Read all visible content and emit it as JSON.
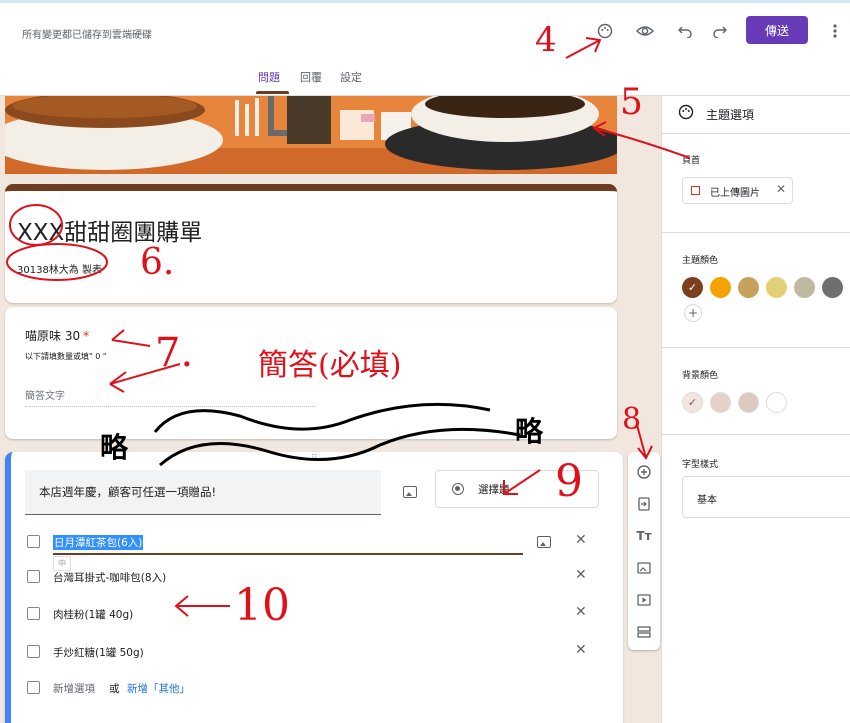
{
  "topbar": {
    "save_status": "所有變更都已儲存到雲端硬碟",
    "send_label": "傳送",
    "icons": [
      "palette-icon",
      "eye-icon",
      "undo-icon",
      "redo-icon",
      "more-vert-icon"
    ]
  },
  "tabs": [
    {
      "label": "問題",
      "active": true
    },
    {
      "label": "回覆",
      "active": false
    },
    {
      "label": "設定",
      "active": false
    }
  ],
  "form": {
    "title": "XXX甜甜圈團購單",
    "description": "30138林大為 製表"
  },
  "question1": {
    "title": "喵原味 30",
    "required_mark": "*",
    "help": "以下請填數量或填\" 0 \"",
    "placeholder": "簡答文字"
  },
  "question2": {
    "title": "本店週年慶，顧客可任選一項贈品!",
    "type_label": "選擇題",
    "ime_hint": "中",
    "options": [
      "日月潭紅茶包(6入)",
      "台灣耳掛式-咖啡包(8入)",
      "肉桂粉(1罐 40g)",
      "手炒紅糖(1罐 50g)"
    ],
    "add_option": "新增選項",
    "or": "或",
    "add_other": "新增「其他」"
  },
  "toolbar": [
    "add-circle-icon",
    "import-icon",
    "title-text-icon",
    "image-icon",
    "video-icon",
    "section-icon"
  ],
  "theme_panel": {
    "title": "主題選項",
    "header_label": "頁首",
    "uploaded_label": "已上傳圖片",
    "theme_color_label": "主題顏色",
    "theme_colors": [
      "#7b3f1d",
      "#f4a200",
      "#c6a15b",
      "#e3cf75",
      "#c0b9a1",
      "#6f6f6f"
    ],
    "background_color_label": "背景顏色",
    "background_colors": [
      "#f2e5df",
      "#e6d1c7",
      "#dccac0",
      "#ffffff"
    ],
    "font_style_label": "字型樣式",
    "font_style_value": "基本"
  },
  "annotations": {
    "n4": "4",
    "n5": "5",
    "n6": "6.",
    "n7": "7.",
    "n7_note": "簡答(必填)",
    "n8": "8",
    "n9": "9",
    "n10": "10",
    "omit_left": "略",
    "omit_right": "略"
  },
  "colors": {
    "accent": "#673ab7",
    "header_bar": "#6d3d22",
    "link": "#1a73e8",
    "annotation": "#e0101a"
  }
}
